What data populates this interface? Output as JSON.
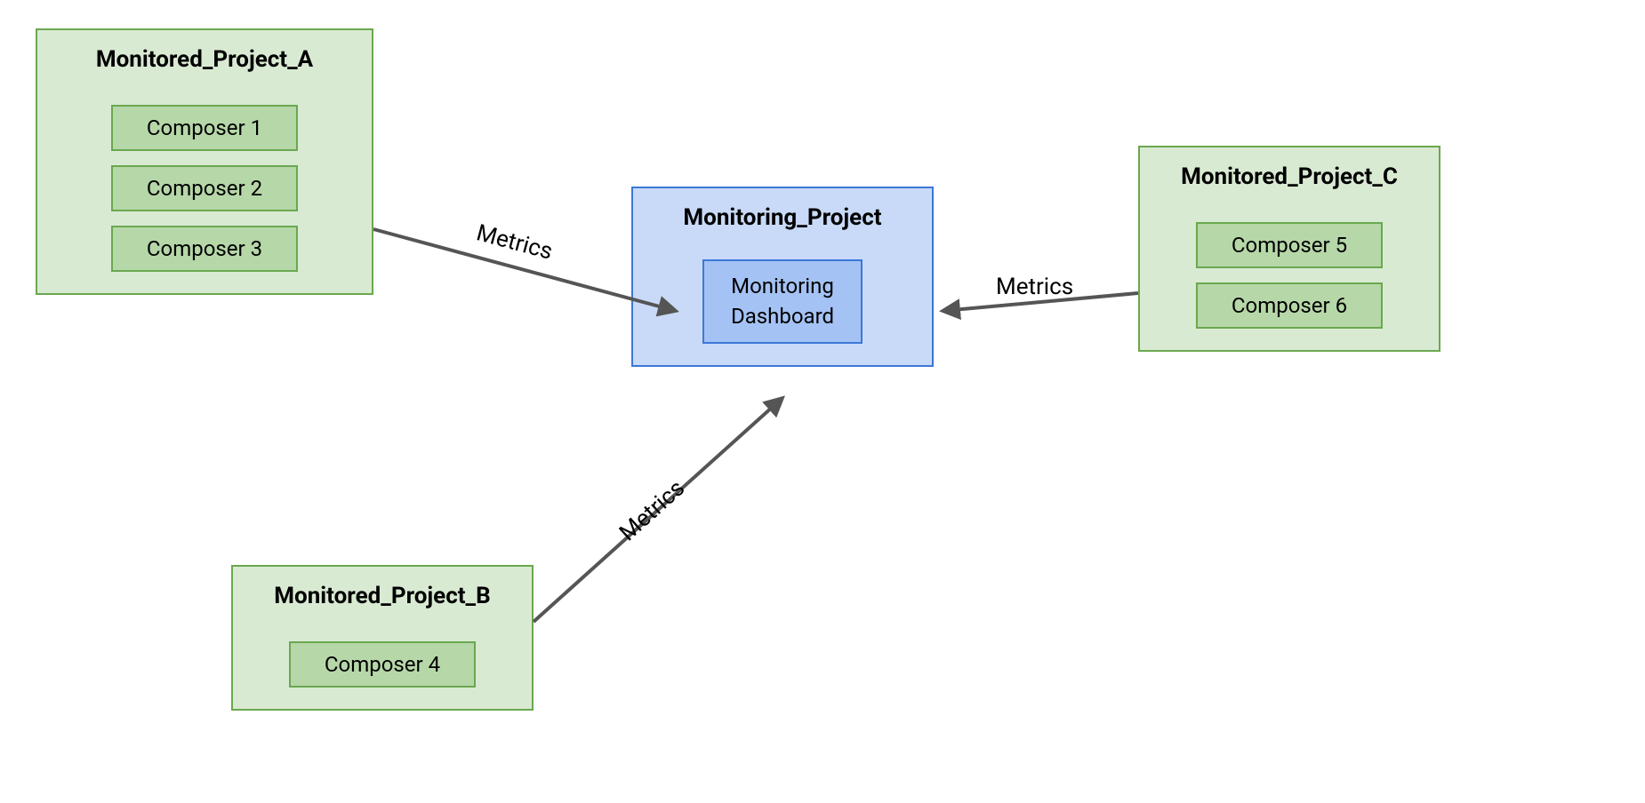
{
  "projectA": {
    "title": "Monitored_Project_A",
    "items": [
      "Composer 1",
      "Composer 2",
      "Composer 3"
    ]
  },
  "projectB": {
    "title": "Monitored_Project_B",
    "items": [
      "Composer 4"
    ]
  },
  "projectC": {
    "title": "Monitored_Project_C",
    "items": [
      "Composer 5",
      "Composer 6"
    ]
  },
  "monitoring": {
    "title": "Monitoring_Project",
    "dashboard": "Monitoring\nDashboard"
  },
  "edges": {
    "labelA": "Metrics",
    "labelB": "Metrics",
    "labelC": "Metrics"
  }
}
